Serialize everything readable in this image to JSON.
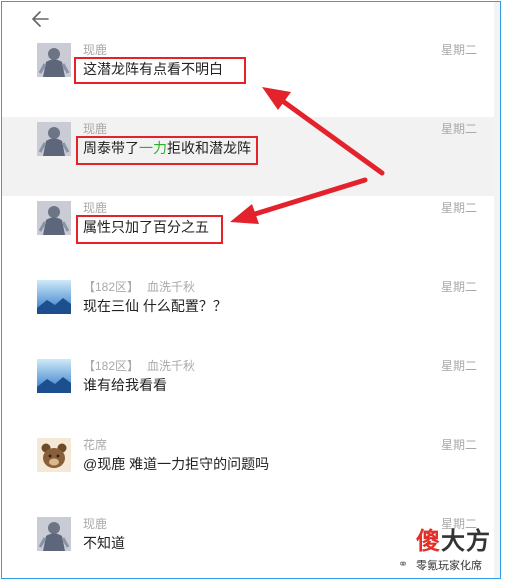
{
  "messages": [
    {
      "avatar": "armored-knight-avatar",
      "sender": "现鹿",
      "time": "星期二",
      "text": "这潜龙阵有点看不明白",
      "highlighted": false
    },
    {
      "avatar": "armored-knight-avatar",
      "sender": "现鹿",
      "time": "星期二",
      "text_parts": [
        "周泰带了",
        "一力",
        "拒收和潜龙阵"
      ],
      "highlighted": true
    },
    {
      "avatar": "armored-knight-avatar",
      "sender": "现鹿",
      "time": "星期二",
      "text": "属性只加了百分之五",
      "highlighted": false
    },
    {
      "avatar": "blue-sky-avatar",
      "region": "【182区】",
      "sender": "血洗千秋",
      "time": "星期二",
      "text": "现在三仙 什么配置？？",
      "highlighted": false
    },
    {
      "avatar": "blue-sky-avatar",
      "region": "【182区】",
      "sender": "血洗千秋",
      "time": "星期二",
      "text": "谁有给我看看",
      "highlighted": false
    },
    {
      "avatar": "bear-avatar",
      "sender": "花席",
      "time": "星期二",
      "text": "@现鹿 难道一力拒守的问题吗",
      "highlighted": false
    },
    {
      "avatar": "armored-knight-avatar",
      "sender": "现鹿",
      "time": "星期二",
      "text": "不知道",
      "highlighted": false
    }
  ],
  "watermark": {
    "logo_red": "傻",
    "logo_dark": "大方",
    "subtitle": "零氪玩家化席"
  },
  "colors": {
    "frame": "#2f9ee8",
    "highlight_row": "#f2f2f2",
    "annotation_red": "#e3222c",
    "mention_green": "#2bb02b"
  }
}
